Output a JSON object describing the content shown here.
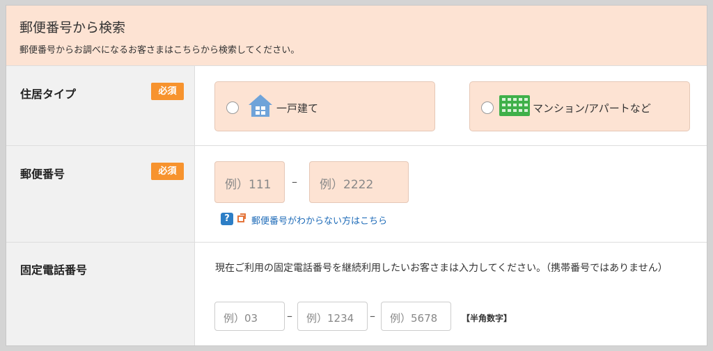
{
  "header": {
    "title": "郵便番号から検索",
    "description": "郵便番号からお調べになるお客さまはこちらから検索してください。"
  },
  "residence": {
    "label": "住居タイプ",
    "required": "必須",
    "options": [
      {
        "label": "一戸建て",
        "icon": "house-icon"
      },
      {
        "label": "マンション/アパートなど",
        "icon": "apartment-icon"
      }
    ]
  },
  "postal": {
    "label": "郵便番号",
    "required": "必須",
    "first_placeholder": "例）111",
    "second_placeholder": "例）2222",
    "separator": "–",
    "help_link": "郵便番号がわからない方はこちら",
    "help_icon": "?"
  },
  "phone": {
    "label": "固定電話番号",
    "note": "現在ご利用の固定電話番号を継続利用したいお客さまは入力してください。（携帯番号ではありません）",
    "placeholders": [
      "例）03",
      "例）1234",
      "例）5678"
    ],
    "separator": "–",
    "unit_note": "【半角数字】"
  },
  "colors": {
    "header_bg": "#fde3d3",
    "required_badge": "#f7932e",
    "link": "#1e6bb8",
    "icon_blue": "#6fa3d9",
    "icon_green": "#3fb04a"
  }
}
